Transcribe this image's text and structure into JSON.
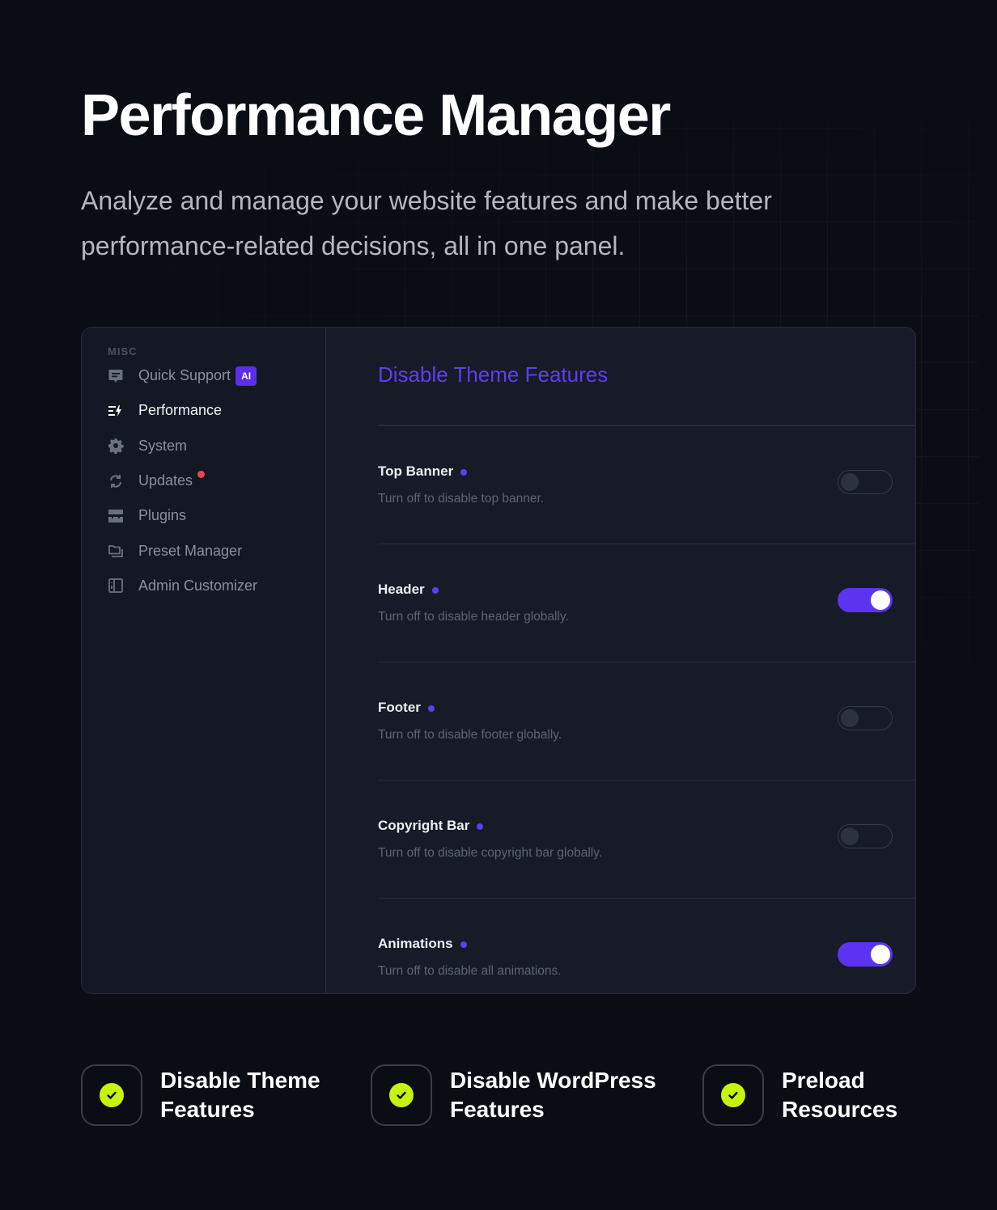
{
  "hero": {
    "title": "Performance Manager",
    "subtitle": "Analyze and manage your website features and make better performance-related decisions, all in one panel."
  },
  "sidebar": {
    "heading": "MISC",
    "items": [
      {
        "label": "Quick Support",
        "icon": "chat-icon",
        "badge": "AI",
        "active": false
      },
      {
        "label": "Performance",
        "icon": "performance-bolt-icon",
        "active": true
      },
      {
        "label": "System",
        "icon": "gear-icon",
        "active": false
      },
      {
        "label": "Updates",
        "icon": "refresh-icon",
        "notification": true,
        "active": false
      },
      {
        "label": "Plugins",
        "icon": "plugins-icon",
        "active": false
      },
      {
        "label": "Preset Manager",
        "icon": "folders-icon",
        "active": false
      },
      {
        "label": "Admin Customizer",
        "icon": "layout-panel-icon",
        "active": false
      }
    ]
  },
  "main": {
    "title": "Disable Theme Features",
    "features": [
      {
        "name": "Top Banner",
        "description": "Turn off to disable top banner.",
        "enabled": false
      },
      {
        "name": "Header",
        "description": "Turn off to disable header globally.",
        "enabled": true
      },
      {
        "name": "Footer",
        "description": "Turn off to disable footer globally.",
        "enabled": false
      },
      {
        "name": "Copyright Bar",
        "description": "Turn off to disable copyright bar globally.",
        "enabled": false
      },
      {
        "name": "Animations",
        "description": "Turn off to disable all animations.",
        "enabled": true
      }
    ]
  },
  "bottom_features": [
    {
      "label": "Disable Theme Features",
      "icon": "check-circle-icon"
    },
    {
      "label": "Disable WordPress Features",
      "icon": "check-circle-icon"
    },
    {
      "label": "Preload Resources",
      "icon": "check-circle-icon"
    }
  ],
  "colors": {
    "accent": "#5b33f0",
    "check": "#c6f40b",
    "notification": "#e5484d",
    "background": "#0a0d14",
    "panel": "#171b27"
  }
}
